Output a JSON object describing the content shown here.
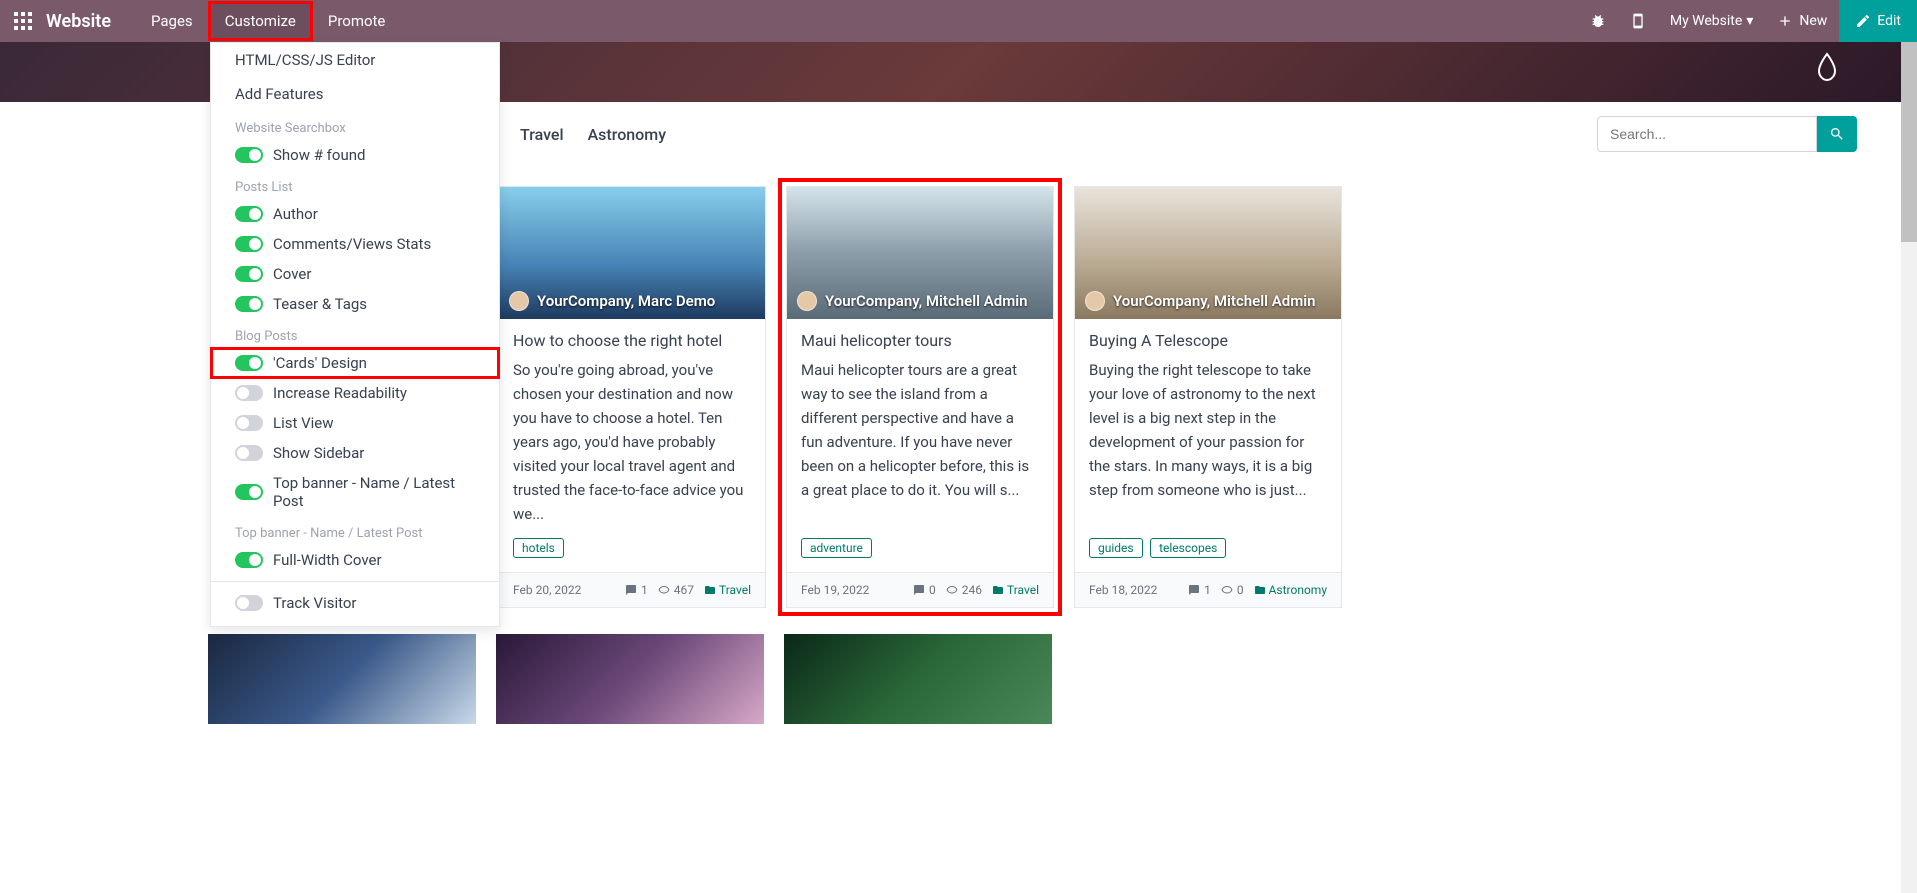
{
  "topbar": {
    "brand": "Website",
    "nav": {
      "pages": "Pages",
      "customize": "Customize",
      "promote": "Promote"
    },
    "my_website": "My Website",
    "new": "New",
    "edit": "Edit"
  },
  "dropdown": {
    "items": {
      "html_editor": "HTML/CSS/JS Editor",
      "add_features": "Add Features"
    },
    "headers": {
      "searchbox": "Website Searchbox",
      "posts_list": "Posts List",
      "blog_posts": "Blog Posts",
      "top_banner": "Top banner - Name / Latest Post"
    },
    "toggles": {
      "show_found": "Show # found",
      "author": "Author",
      "comments_views": "Comments/Views Stats",
      "cover": "Cover",
      "teaser_tags": "Teaser & Tags",
      "cards_design": "'Cards' Design",
      "increase_readability": "Increase Readability",
      "list_view": "List View",
      "show_sidebar": "Show Sidebar",
      "top_banner": "Top banner - Name / Latest Post",
      "full_width_cover": "Full-Width Cover",
      "track_visitor": "Track Visitor"
    }
  },
  "filters": {
    "travel": "Travel",
    "astronomy": "Astronomy"
  },
  "search": {
    "placeholder": "Search..."
  },
  "cards": [
    {
      "author": "YourCompany, Marc Demo",
      "title": "How to choose the right hotel",
      "text": "So you're going abroad, you've chosen your destination and now you have to choose a hotel. Ten years ago, you'd have probably visited your local travel agent and trusted the face-to-face advice you we...",
      "tags": [
        "hotels"
      ],
      "date": "Feb 20, 2022",
      "comments": "1",
      "views": "467",
      "category": "Travel"
    },
    {
      "author": "YourCompany, Mitchell Admin",
      "title": "Maui helicopter tours",
      "text": "Maui helicopter tours are a great way to see the island from a different perspective and have a fun adventure. If you have never been on a helicopter before, this is a great place to do it. You will s...",
      "tags": [
        "adventure"
      ],
      "date": "Feb 19, 2022",
      "comments": "0",
      "views": "246",
      "category": "Travel"
    },
    {
      "author": "YourCompany, Mitchell Admin",
      "title": "Buying A Telescope",
      "text": "Buying the right telescope to take your love of astronomy to the next level is a big next step in the development of your passion for the stars. In many ways, it is a big step from someone who is just...",
      "tags": [
        "guides",
        "telescopes"
      ],
      "date": "Feb 18, 2022",
      "comments": "1",
      "views": "0",
      "category": "Astronomy"
    }
  ]
}
